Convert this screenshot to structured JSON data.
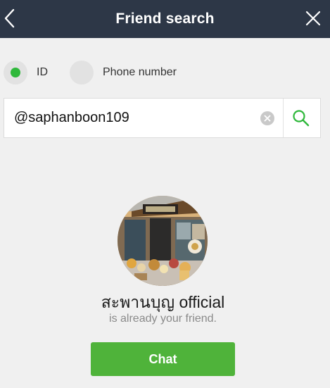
{
  "header": {
    "title": "Friend search",
    "back_icon": "chevron-left-icon",
    "close_icon": "close-icon",
    "background": "#2d3747"
  },
  "search_type": {
    "options": [
      {
        "label": "ID",
        "selected": true
      },
      {
        "label": "Phone number",
        "selected": false
      }
    ],
    "selected_color": "#2fb83b"
  },
  "search": {
    "value": "@saphanboon109",
    "clear_icon": "clear-icon",
    "search_icon": "search-icon",
    "icon_color": "#2fb83b"
  },
  "result": {
    "name": "สะพานบุญ official",
    "status": "is already your friend.",
    "avatar": "storefront-photo"
  },
  "actions": {
    "chat_label": "Chat",
    "chat_color": "#4fb33a"
  }
}
